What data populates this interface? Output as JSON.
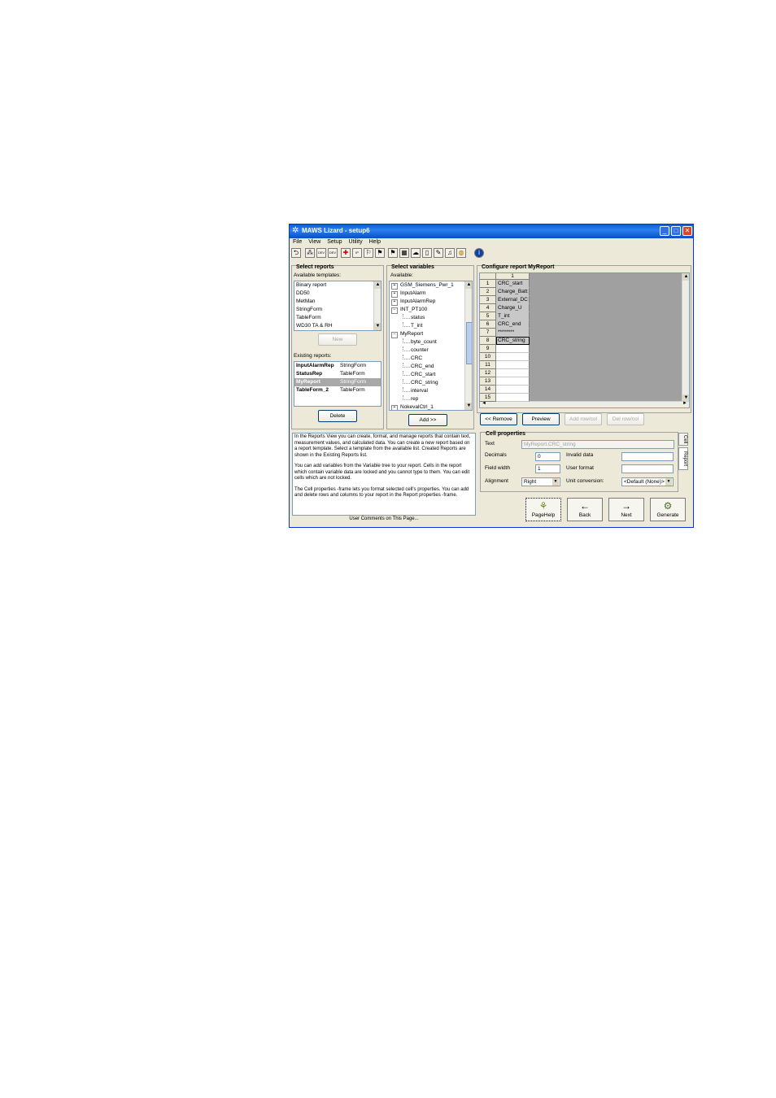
{
  "window": {
    "title": "MAWS Lizard - setup6",
    "app_icon": "lizard-icon",
    "controls": [
      "minimize-icon",
      "maximize-icon",
      "close-icon"
    ]
  },
  "menu": [
    "File",
    "View",
    "Setup",
    "Utility",
    "Help"
  ],
  "toolbar": {
    "icons": [
      "back-arrow-icon",
      "network-icon",
      "dev-icon",
      "dev-icon",
      "connect-icon",
      "ip-icon",
      "run-icon",
      "run-icon",
      "flag-icon",
      "table-icon",
      "cloud-icon",
      "page-icon",
      "pencil-icon",
      "bell-icon",
      "globe-icon",
      "info-icon"
    ],
    "dev_label": "DEV",
    "ip_label": "IP"
  },
  "select_reports": {
    "title": "Select reports",
    "available_label": "Available templates:",
    "templates": [
      "Binary report",
      "DD50",
      "MetMan",
      "StringForm",
      "TableForm",
      "WD30 TA & RH"
    ],
    "new_button": "New",
    "existing_label": "Existing reports:",
    "existing": [
      {
        "name": "InputAlarmRep",
        "type": "StringForm"
      },
      {
        "name": "StatusRep",
        "type": "TableForm"
      },
      {
        "name": "MyReport",
        "type": "StringForm"
      },
      {
        "name": "TableForm_2",
        "type": "TableForm"
      }
    ],
    "selected_index": 2,
    "delete_button": "Delete"
  },
  "select_variables": {
    "title": "Select variables",
    "available_label": "Available:",
    "tree": [
      {
        "label": "GSM_Siemens_Pwr_1",
        "level": 0,
        "expander": "+"
      },
      {
        "label": "InputAlarm",
        "level": 0,
        "expander": "+"
      },
      {
        "label": "InputAlarmRep",
        "level": 0,
        "expander": "+"
      },
      {
        "label": "INT_PT100",
        "level": 0,
        "expander": "−"
      },
      {
        "label": "status",
        "level": 1,
        "expander": ""
      },
      {
        "label": "T_int",
        "level": 1,
        "expander": ""
      },
      {
        "label": "MyReport",
        "level": 0,
        "expander": "−"
      },
      {
        "label": "byte_count",
        "level": 1,
        "expander": ""
      },
      {
        "label": "counter",
        "level": 1,
        "expander": ""
      },
      {
        "label": "CRC",
        "level": 1,
        "expander": ""
      },
      {
        "label": "CRC_end",
        "level": 1,
        "expander": ""
      },
      {
        "label": "CRC_start",
        "level": 1,
        "expander": ""
      },
      {
        "label": "CRC_string",
        "level": 1,
        "expander": ""
      },
      {
        "label": "interval",
        "level": 1,
        "expander": ""
      },
      {
        "label": "rep",
        "level": 1,
        "expander": ""
      },
      {
        "label": "NokevalCtrl_1",
        "level": 0,
        "expander": "+"
      }
    ],
    "add_button": "Add >>"
  },
  "configure_report": {
    "title": "Configure report MyReport",
    "column_header": "1",
    "rows": [
      {
        "num": "1",
        "value": "CRC_start"
      },
      {
        "num": "2",
        "value": "Charge_Batt"
      },
      {
        "num": "3",
        "value": "External_DC"
      },
      {
        "num": "4",
        "value": "Charge_U"
      },
      {
        "num": "5",
        "value": "T_int"
      },
      {
        "num": "6",
        "value": "CRC_end"
      },
      {
        "num": "7",
        "value": "********"
      },
      {
        "num": "8",
        "value": "CRC_string"
      },
      {
        "num": "9",
        "value": ""
      },
      {
        "num": "10",
        "value": ""
      },
      {
        "num": "11",
        "value": ""
      },
      {
        "num": "12",
        "value": ""
      },
      {
        "num": "13",
        "value": ""
      },
      {
        "num": "14",
        "value": ""
      },
      {
        "num": "15",
        "value": ""
      }
    ],
    "selected_row": 7,
    "buttons": {
      "remove": "<< Remove",
      "preview": "Preview",
      "add_rowcol": "Add row/col",
      "del_rowcol": "Del row/col"
    }
  },
  "cell_properties": {
    "title": "Cell properties",
    "text_label": "Text",
    "text_value": "MyReport.CRC_string",
    "decimals_label": "Decimals",
    "decimals_value": "0",
    "field_width_label": "Field width",
    "field_width_value": "1",
    "alignment_label": "Alignment",
    "alignment_value": "Right",
    "invalid_label": "Invalid data",
    "invalid_value": "",
    "user_format_label": "User format",
    "user_format_value": "",
    "unit_label": "Unit conversion:",
    "unit_value": "<Default (None)>",
    "side_tabs": [
      "Cell",
      "Report"
    ]
  },
  "help": {
    "para1": "In the Reports View you can create, format, and manage reports that contain text, measurement values, and calculated data. You can create a new report based on a report template. Select a template from the available list. Created Reports are shown in the Existing Reports list.",
    "para2": "You can add variables from the Variable tree to your report. Cells in the report which contain variable data are locked and you cannot type to them. You can edit cells which are not locked.",
    "para3": "The Cell properties -frame lets you format selected cell's properties. You can add and delete rows and columns to your report in the Report properties -frame.",
    "footer": "User Comments on This Page..."
  },
  "nav": {
    "pagehelp": "PageHelp",
    "back": "Back",
    "next": "Next",
    "generate": "Generate"
  },
  "colors": {
    "titlebar": "#0a5fd8",
    "selection": "#316ac5",
    "selected_grey": "#a8a8a8",
    "window_bg": "#ece9d8",
    "grid_bg": "#a0a0a0"
  }
}
